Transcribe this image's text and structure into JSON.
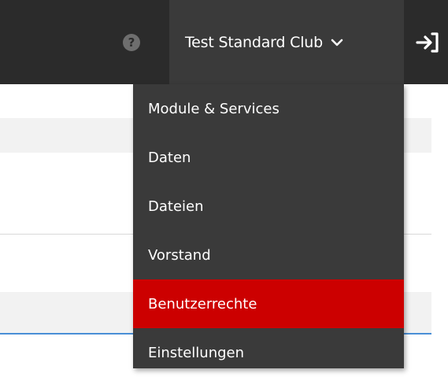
{
  "topbar": {
    "help_icon_glyph": "?",
    "club_name": "Test Standard Club",
    "chevron_icon": "chevron-down-icon",
    "logout_icon": "sign-in-icon"
  },
  "dropdown": {
    "items": [
      {
        "label": "Module & Services",
        "active": false
      },
      {
        "label": "Daten",
        "active": false
      },
      {
        "label": "Dateien",
        "active": false
      },
      {
        "label": "Vorstand",
        "active": false
      },
      {
        "label": "Benutzerrechte",
        "active": true
      },
      {
        "label": "Einstellungen",
        "active": false
      }
    ]
  },
  "colors": {
    "topbar": "#2b2b2b",
    "menu_bg": "#3a3a3a",
    "active": "#cc0000",
    "accent_line": "#4a8fd6"
  }
}
